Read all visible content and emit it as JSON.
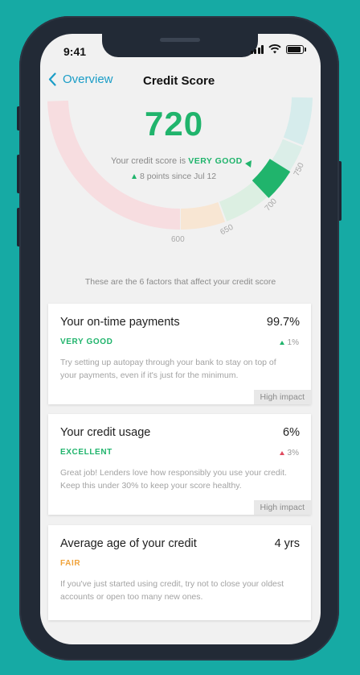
{
  "status": {
    "time": "9:41"
  },
  "nav": {
    "back_label": "Overview",
    "title": "Credit Score"
  },
  "score": {
    "value": "720",
    "text_prefix": "Your credit score is ",
    "rating": "VERY GOOD",
    "change": "8 points since Jul 12",
    "ticks": [
      "600",
      "650",
      "700",
      "750"
    ]
  },
  "colors": {
    "accent": "#1a9dc7",
    "good": "#20b46c",
    "fair": "#f0a33b",
    "bad": "#e04a5f",
    "background": "#16aaa4"
  },
  "factors_intro": "These are the 6 factors that affect your credit score",
  "factors": [
    {
      "title": "Your on-time payments",
      "value": "99.7%",
      "rating": "VERY GOOD",
      "delta": "1%",
      "desc": "Try setting up autopay through your bank to stay on top of your payments, even if it's just for the minimum.",
      "impact": "High impact"
    },
    {
      "title": "Your credit usage",
      "value": "6%",
      "rating": "EXCELLENT",
      "delta": "3%",
      "desc": "Great job! Lenders love how responsibly you use your credit. Keep this under 30% to keep your score healthy.",
      "impact": "High impact"
    },
    {
      "title": "Average age of your credit",
      "value": "4 yrs",
      "rating": "FAIR",
      "desc": "If you've just started using credit, try not to close your oldest accounts or open too many new ones."
    }
  ]
}
